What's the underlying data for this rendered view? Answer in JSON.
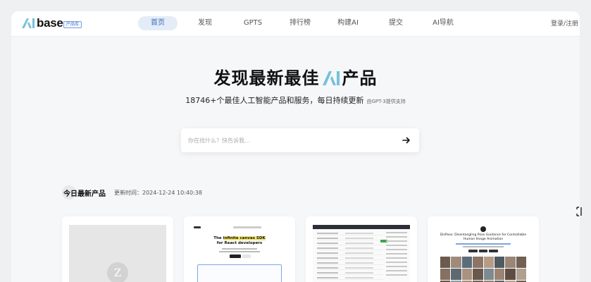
{
  "header": {
    "logo_text": "base",
    "logo_badge": "产品库",
    "nav": [
      "首页",
      "发现",
      "GPTS",
      "排行榜",
      "构建AI",
      "提交",
      "AI导航"
    ],
    "active_index": 0,
    "login": "登录/注册"
  },
  "hero": {
    "title_before": "发现最新最佳",
    "title_after": "产品",
    "subtitle": "18746+个最佳人工智能产品和服务，每日持续更新",
    "subtitle_note": "由GPT-3提供支持"
  },
  "search": {
    "placeholder": "你在找什么？快告诉我..."
  },
  "section": {
    "title": "今日最新产品",
    "updated": "更新时间：2024-12-24 10:40:38"
  },
  "cards": {
    "c1_initial": "Z",
    "c2_headline_1": "The",
    "c2_headline_hl": "infinite canvas SDK",
    "c2_headline_2": "for React developers",
    "c4_title": "DisPose: Disentangling Pose Guidance for Controllable Human Image Animation"
  },
  "colors": {
    "active_nav_bg": "#e3ecf7",
    "active_nav_text": "#3b6bb5",
    "brand_gradient": [
      "#6fd3d6",
      "#8fb6f2"
    ]
  },
  "icons": {
    "search_submit": "arrow-right-icon",
    "side": "expand-icon"
  }
}
